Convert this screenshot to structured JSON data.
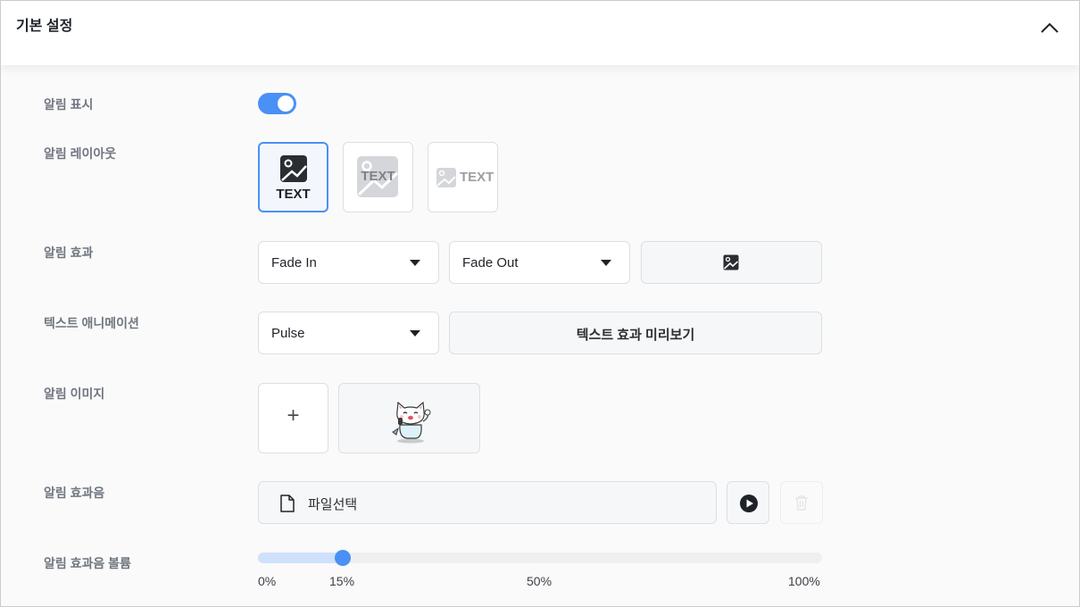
{
  "header": {
    "title": "기본 설정",
    "collapse_icon": "chevron-up-icon"
  },
  "rows": {
    "display": {
      "label": "알림 표시",
      "enabled": true
    },
    "layout": {
      "label": "알림 레이아웃",
      "options": [
        {
          "text": "TEXT",
          "selected": true
        },
        {
          "text": "TEXT",
          "selected": false
        },
        {
          "text": "TEXT",
          "selected": false
        }
      ]
    },
    "effect": {
      "label": "알림 효과",
      "in_value": "Fade In",
      "out_value": "Fade Out",
      "preview_icon": "image-icon"
    },
    "text_animation": {
      "label": "텍스트 애니메이션",
      "value": "Pulse",
      "preview_label": "텍스트 효과 미리보기"
    },
    "image": {
      "label": "알림 이미지",
      "add_label": "+"
    },
    "sound": {
      "label": "알림 효과음",
      "file_label": "파일선택"
    },
    "volume": {
      "label": "알림 효과음 볼륨",
      "value_percent": 15,
      "ticks": [
        "0%",
        "15%",
        "50%",
        "100%"
      ]
    }
  },
  "colors": {
    "accent": "#4a90f5",
    "accent_light": "#cfe0fb"
  }
}
